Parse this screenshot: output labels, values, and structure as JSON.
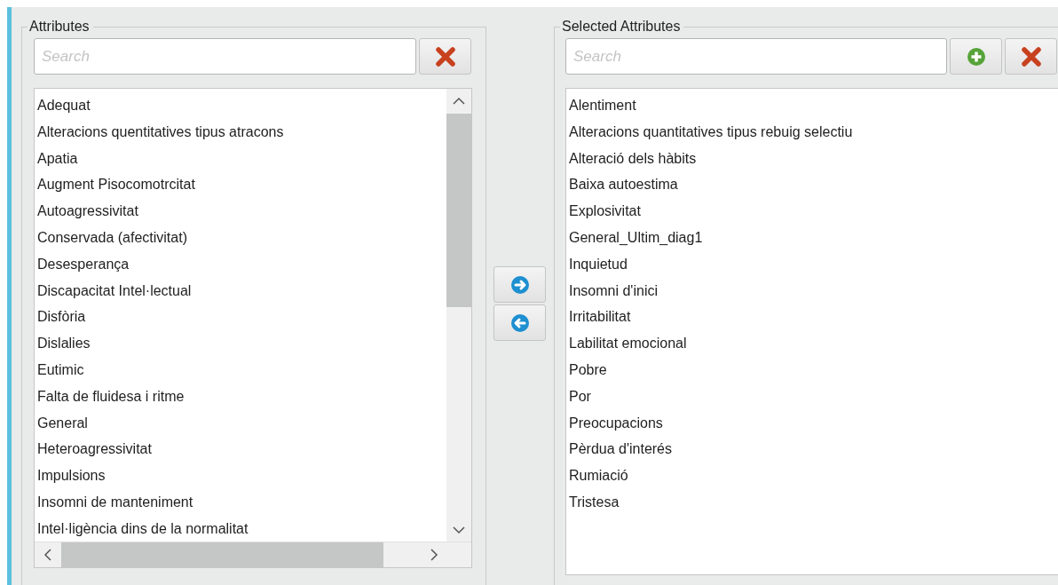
{
  "attributes": {
    "title": "Attributes",
    "search": {
      "placeholder": "Search"
    },
    "items": [
      "Adequat",
      "Alteracions quentitatives tipus atracons",
      "Apatia",
      "Augment Pisocomotrcitat",
      "Autoagressivitat",
      "Conservada (afectivitat)",
      "Desesperança",
      "Discapacitat Intel·lectual",
      "Disfòria",
      "Dislalies",
      "Eutimic",
      "Falta de fluidesa i ritme",
      "General",
      "Heteroagressivitat",
      "Impulsions",
      "Insomni de manteniment",
      "Intel·ligència dins de la normalitat"
    ]
  },
  "selected_attributes": {
    "title": "Selected Attributes",
    "search": {
      "placeholder": "Search"
    },
    "items": [
      "Alentiment",
      "Alteracions quantitatives tipus rebuig selectiu",
      "Alteració dels hàbits",
      "Baixa autoestima",
      "Explosivitat",
      "General_Ultim_diag1",
      "Inquietud",
      "Insomni d'inici",
      "Irritabilitat",
      "Labilitat emocional",
      "Pobre",
      "Por",
      "Preocupacions",
      "Pèrdua d'interés",
      "Rumiació",
      "Tristesa"
    ]
  }
}
